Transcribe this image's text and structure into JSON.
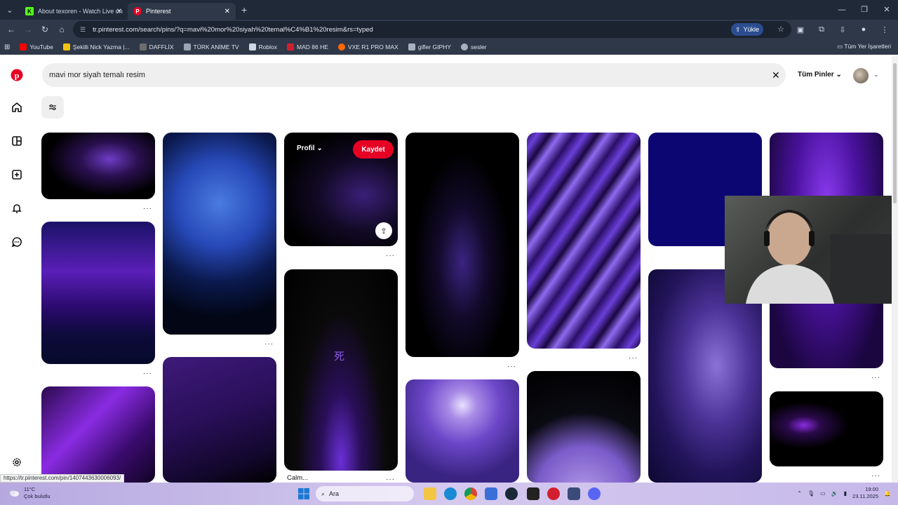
{
  "browser": {
    "tabs": [
      {
        "title": "About texoren - Watch Live on",
        "favicon": "K",
        "favicon_color": "#53fc18",
        "active": false
      },
      {
        "title": "Pinterest",
        "favicon": "P",
        "favicon_color": "#e60023",
        "active": true
      }
    ],
    "url": "tr.pinterest.com/search/pins/?q=mavi%20mor%20siyah%20temal%C4%B1%20resim&rs=typed",
    "upload_label": "Yükle",
    "bookmarks": [
      {
        "label": "YouTube",
        "color": "#ff0000"
      },
      {
        "label": "Şekilli Nick Yazma |...",
        "color": "#f1c40f"
      },
      {
        "label": "DAFFLİX",
        "color": "#6c6c6c"
      },
      {
        "label": "TÜRK ANİME TV",
        "color": "#9aa4b2"
      },
      {
        "label": "Roblox",
        "color": "#cfd6e4"
      },
      {
        "label": "MAD 86 HE",
        "color": "#d21f2f"
      },
      {
        "label": "VXE R1 PRO MAX",
        "color": "#ff6a00"
      },
      {
        "label": "gifler GIPHY",
        "color": "#a7b0bf"
      },
      {
        "label": "sesler",
        "color": "#a7b0bf"
      }
    ],
    "all_bookmarks_label": "Tüm Yer İşaretleri",
    "status_url": "https://tr.pinterest.com/pin/1407443630006093/"
  },
  "pinterest": {
    "search_value": "mavi mor siyah temalı resim",
    "filter_label": "Tüm Pinler",
    "hover_pin": {
      "profile_label": "Profil",
      "save_label": "Kaydet"
    },
    "calm_caption": "Calm...",
    "kanji": "死",
    "dots": "···"
  },
  "taskbar": {
    "temperature": "11°C",
    "weather_text": "Çok bulutlu",
    "search_placeholder": "Ara",
    "time": "19:00",
    "date": "23.11.2025"
  }
}
